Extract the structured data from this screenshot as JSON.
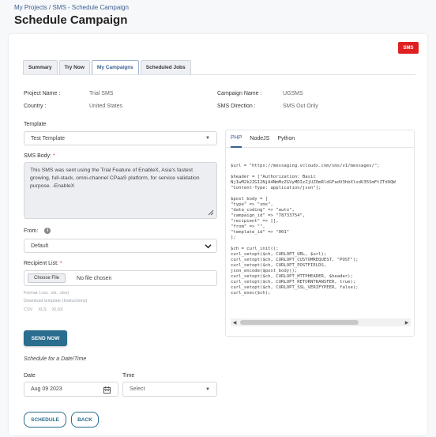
{
  "breadcrumb": "My Projects / SMS - Schedule Campaign",
  "page_title": "Schedule Campaign",
  "badge": "SMS",
  "tabs": [
    {
      "label": "Summary",
      "active": false
    },
    {
      "label": "Try Now",
      "active": false
    },
    {
      "label": "My Campaigns",
      "active": true
    },
    {
      "label": "Scheduled Jobs",
      "active": false
    }
  ],
  "info": {
    "project_name_label": "Project Name :",
    "project_name": "Trial SMS",
    "country_label": "Country :",
    "country": "United States",
    "campaign_name_label": "Campaign Name :",
    "campaign_name": "UGSMS",
    "sms_direction_label": "SMS Direction :",
    "sms_direction": "SMS Out Only"
  },
  "template": {
    "label": "Template",
    "value": "Test Template"
  },
  "sms_body": {
    "label": "SMS Body:",
    "value": "This SMS was sent using the Trial Feature of EnableX, Asia's fastest growing, full-stack, omni-channel CPaaS platform, for service validation purpose. -EnableX"
  },
  "from": {
    "label": "From:",
    "value": "Default"
  },
  "recipient": {
    "label": "Recipient List:",
    "choose_file": "Choose File",
    "no_file": "No file chosen",
    "hint": "Format (.csv, .xls, .xlsx)",
    "download_label": "Download template (Instructions)",
    "download_links": [
      "CSV",
      "XLS",
      "XLSX"
    ]
  },
  "send_now": "SEND NOW",
  "schedule_heading": "Schedule for a Date/Time",
  "date": {
    "label": "Date",
    "value": "Aug 09 2023"
  },
  "time": {
    "label": "Time",
    "placeholder": "Select"
  },
  "buttons": {
    "schedule": "SCHEDULE",
    "back": "BACK"
  },
  "code_panel": {
    "tabs": [
      {
        "label": "PHP",
        "active": true
      },
      {
        "label": "NodeJS",
        "active": false
      },
      {
        "label": "Python",
        "active": false
      }
    ],
    "code": "$url = \"https://messaging.vcloudx.com/sms/v1/messages/\";\n\n$header = [\"Authorization: Basic\nNjIwM2k2ZGI2NjA4NmMzZGVyMDIzZjUZOmRldGFadV3hbXlxdU35SmFtZTd9QW\n\"Content-Type: application/json\"];\n\n$post_body = [\n\"type\" => \"sms\",\n\"data_coding\" => \"auto\",\n\"campaign_id\" => \"78733754\",\n\"recipient\" => [],\n\"from\" => \"\",\n\"template_id\" => \"001\"\n];\n\n$ch = curl_init();\ncurl_setopt($ch, CURLOPT_URL, $url);\ncurl_setopt($ch, CURLOPT_CUSTOMREQUEST, \"POST\");\ncurl_setopt($ch, CURLOPT_POSTFIELDS,\njson_encode($post_body));\ncurl_setopt($ch, CURLOPT_HTTPHEADER, $header);\ncurl_setopt($ch, CURLOPT_RETURNTRANSFER, true);\ncurl_setopt($ch, CURLOPT_SSL_VERIFYPEER, false);\ncurl_exec($ch);"
  },
  "colors": {
    "accent": "#2b6d8f",
    "badge": "#e02020",
    "link": "#3b5f92"
  },
  "icons": [
    "chevron-down-icon",
    "info-icon",
    "calendar-icon",
    "resize-handle-icon"
  ]
}
